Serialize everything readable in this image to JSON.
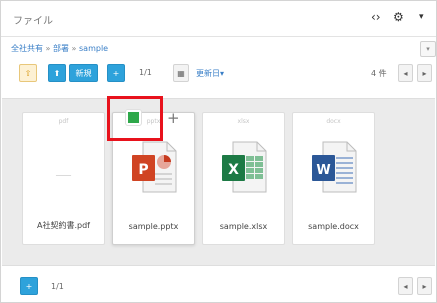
{
  "header": {
    "title": "ファイル",
    "icons": [
      "code-icon",
      "gear-icon",
      "chevron-down-icon"
    ]
  },
  "breadcrumb": {
    "items": [
      "全社共有",
      "部署",
      "sample"
    ],
    "separator": "»"
  },
  "toolbar": {
    "new_label": "新規",
    "page_indicator": "1/1",
    "sort_label": "更新日▾",
    "count_label": "4 件"
  },
  "files": [
    {
      "ext": "pdf",
      "name": "A社契約書.pdf",
      "icon": "pdf-thumbnail",
      "thumb_text": "─────"
    },
    {
      "ext": "pptx",
      "name": "sample.pptx",
      "icon": "powerpoint-icon",
      "color": "#d04423"
    },
    {
      "ext": "xlsx",
      "name": "sample.xlsx",
      "icon": "excel-icon",
      "color": "#1d7a45"
    },
    {
      "ext": "docx",
      "name": "sample.docx",
      "icon": "word-icon",
      "color": "#2b5797"
    }
  ],
  "footer": {
    "page_indicator": "1/1"
  },
  "colors": {
    "accent_blue": "#2ea2db",
    "highlight_red": "#e8121c",
    "check_green": "#2ea84a"
  }
}
